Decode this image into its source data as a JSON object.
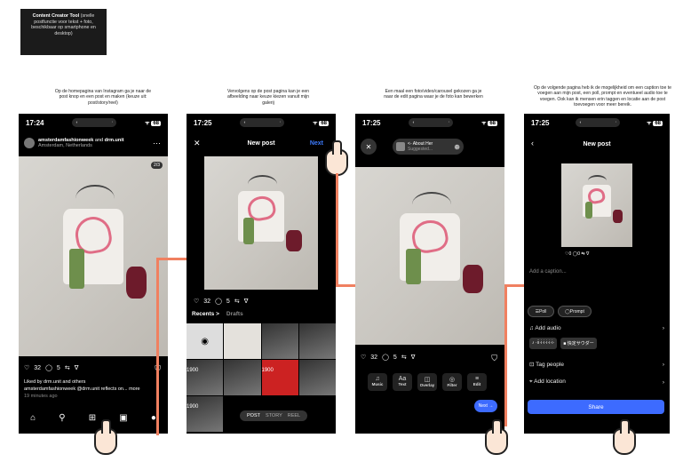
{
  "note": {
    "title": "Content Creator Tool",
    "body": " (snelle postfunctie voor tekst + foto, beschikbaar op smartphone en desktop)"
  },
  "captions": [
    "Op de homepagina van Instagram ga je naar de post knop en een post en maken (keuze uit: post/story/reel)",
    "Vervolgens op de post pagina kan je een afbeelding naar keuze kiezen vanuit mijn galerij",
    "Een maal een foto/video/carousel gekozen ga je naar de edit pagina waar je de foto kan bewerken",
    "Op de volgende pagina heb ik de mogelijkheid om een caption toe te voegen aan mijn post, een poll, prompt en eventueel audio toe te voegen. Ook kan ik mensen erin taggen en locatie aan de post toevoegen voor meer bereik."
  ],
  "status_time": "17:24",
  "status_time_2": "17:25",
  "battery": "68",
  "screen1": {
    "user": "amsterdamfashionweek",
    "and": " and ",
    "collab": "drm.unit",
    "location": "Amsterdam, Netherlands",
    "counter": "2/3",
    "likes": "32",
    "comments": "5",
    "liked_by": "Liked by drm.unit and others",
    "caption": "amsterdamfashionweek @drm.unit reflects on... more",
    "time": "19 minutes ago"
  },
  "screen2": {
    "title": "New post",
    "next": "Next",
    "likes": "32",
    "comments": "5",
    "recents": "Recents >",
    "drafts": "Drafts",
    "modes": [
      "POST",
      "STORY",
      "REEL"
    ],
    "thumb_labels": [
      "1900",
      "1900",
      "1900"
    ]
  },
  "screen3": {
    "audio_title": "<- About Her",
    "audio_sub": "Suggested...",
    "likes": "32",
    "comments": "5",
    "tools": [
      {
        "icon": "♫",
        "label": "Music"
      },
      {
        "icon": "Aa",
        "label": "Text"
      },
      {
        "icon": "◫",
        "label": "Overlay"
      },
      {
        "icon": "◎",
        "label": "Filter"
      },
      {
        "icon": "≡",
        "label": "Edit"
      }
    ],
    "next": "Next →"
  },
  "screen4": {
    "title": "New post",
    "counts": "♡0 ◯0 ⇆ ∇",
    "caption_placeholder": "Add a caption...",
    "poll": "Poll",
    "prompt": "Prompt",
    "add_audio": "Add audio",
    "audio_track": "♪ ·ı̇ı̇·ı̇·ı̇·ı̇·ı̇·ı̇·",
    "audio_track_2": "■ 快定サウダー",
    "tag_people": "Tag people",
    "add_location": "Add location",
    "share": "Share"
  }
}
